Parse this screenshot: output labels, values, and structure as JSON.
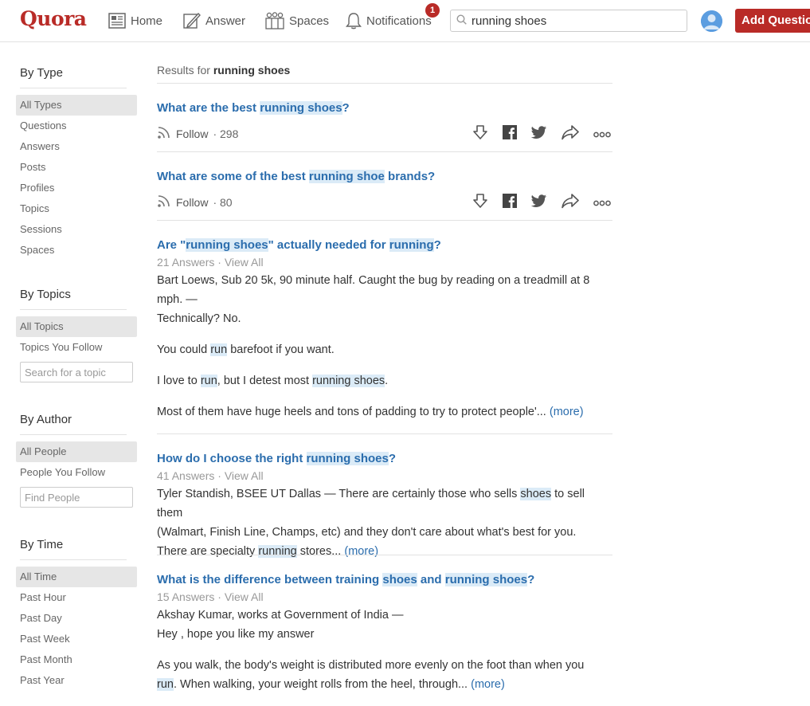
{
  "header": {
    "logo": "Quora",
    "nav": [
      {
        "label": "Home",
        "icon": "home-icon"
      },
      {
        "label": "Answer",
        "icon": "pencil-icon"
      },
      {
        "label": "Spaces",
        "icon": "spaces-icon"
      },
      {
        "label": "Notifications",
        "icon": "bell-icon"
      }
    ],
    "notification_count": "1",
    "search_value": "running shoes",
    "add_question": "Add Question",
    "accent": "#b92b27"
  },
  "sidebar": {
    "type": {
      "heading": "By Type",
      "items": [
        "All Types",
        "Questions",
        "Answers",
        "Posts",
        "Profiles",
        "Topics",
        "Sessions",
        "Spaces"
      ]
    },
    "topics": {
      "heading": "By Topics",
      "items": [
        "All Topics",
        "Topics You Follow"
      ],
      "search_placeholder": "Search for a topic"
    },
    "author": {
      "heading": "By Author",
      "items": [
        "All People",
        "People You Follow"
      ],
      "search_placeholder": "Find People"
    },
    "time": {
      "heading": "By Time",
      "items": [
        "All Time",
        "Past Hour",
        "Past Day",
        "Past Week",
        "Past Month",
        "Past Year"
      ]
    }
  },
  "results": {
    "prefix": "Results for",
    "query": "running shoes",
    "follow_label": "Follow",
    "more_label": "(more)",
    "q1": {
      "t1": "What are the best ",
      "h1": "running shoes",
      "t2": "?",
      "followers": "· 298"
    },
    "q2": {
      "t1": "What are some of the best ",
      "h1": "running shoe",
      "t2": " brands?",
      "followers": "· 80"
    },
    "q3": {
      "t1": "Are \"",
      "h1": "running shoes",
      "t2": "\" actually needed for ",
      "h2": "running",
      "t3": "?",
      "meta": "21 Answers · View All",
      "byline1": "Bart Loews, Sub 20 5k, 90 minute half. Caught the bug by reading on a treadmill at 8",
      "byline2": "mph. —",
      "line3": "Technically? No.",
      "p2a": "You could ",
      "p2h": "run",
      "p2b": " barefoot if you want.",
      "p3a": "I love to ",
      "p3h1": "run",
      "p3b": ", but I detest most ",
      "p3h2": "running shoes",
      "p3c": ".",
      "p4": "Most of them have huge heels and tons of padding to try to protect people'... "
    },
    "q4": {
      "t1": "How do I choose the right ",
      "h1": "running shoes",
      "t2": "?",
      "meta": "41 Answers · View All",
      "l1a": "Tyler Standish, BSEE UT Dallas — There are certainly those who sells ",
      "l1h": "shoes",
      "l1b": " to sell them",
      "l2": "(Walmart, Finish Line, Champs, etc) and they don't care about what's best for you.",
      "l3a": "There are specialty ",
      "l3h": "running",
      "l3b": " stores... "
    },
    "q5": {
      "t1": "What is the difference between training ",
      "h1": "shoes",
      "t2": " and ",
      "h2": "running shoes",
      "t3": "?",
      "meta": "15 Answers · View All",
      "l1": "Akshay Kumar, works at Government of India —",
      "l2": "Hey , hope you like my answer",
      "l3": "As you walk, the body's weight is distributed more evenly on the foot than when you",
      "l4h": "run",
      "l4b": ". When walking, your weight rolls from the heel, through... "
    }
  }
}
